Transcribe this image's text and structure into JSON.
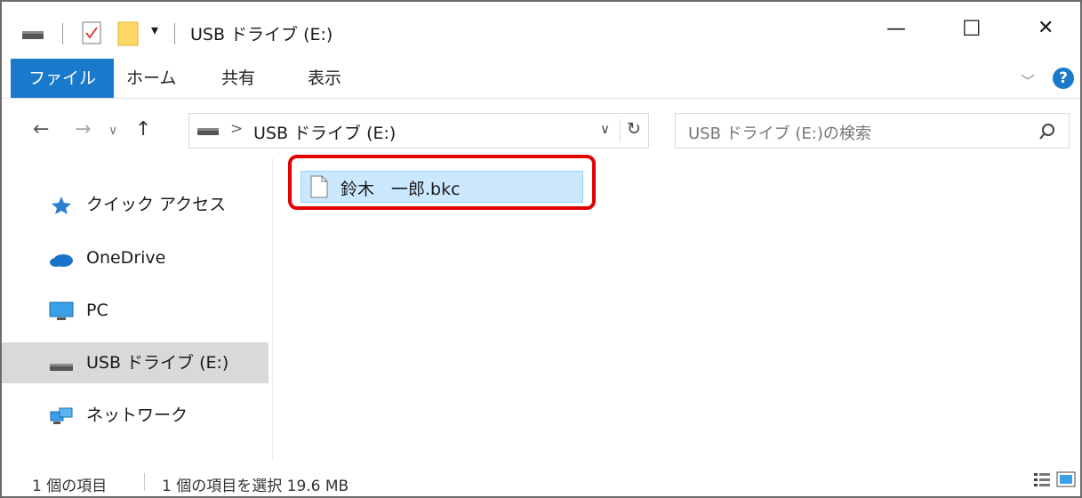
{
  "window": {
    "title": "USB ドライブ (E:)",
    "controls": {
      "minimize": "—",
      "maximize": "☐",
      "close": "✕"
    }
  },
  "ribbon": {
    "tabs": [
      "ファイル",
      "ホーム",
      "共有",
      "表示"
    ],
    "help_label": "?"
  },
  "address": {
    "path_sep": ">",
    "path": "USB ドライブ (E:)",
    "search_placeholder": "USB ドライブ (E:)の検索"
  },
  "nav": {
    "items": [
      {
        "label": "クイック アクセス",
        "icon": "star-icon"
      },
      {
        "label": "OneDrive",
        "icon": "cloud-icon"
      },
      {
        "label": "PC",
        "icon": "monitor-icon"
      },
      {
        "label": "USB ドライブ (E:)",
        "icon": "drive-icon",
        "selected": true
      },
      {
        "label": "ネットワーク",
        "icon": "network-icon"
      }
    ]
  },
  "files": [
    {
      "name": "鈴木　一郎.bkc",
      "selected": true
    }
  ],
  "status": {
    "count": "1 個の項目",
    "selected": "1 個の項目を選択  19.6 MB"
  },
  "colors": {
    "accent": "#1979ca",
    "selection": "#cce8ff",
    "highlight_box": "#e00000",
    "help": "#1979ca"
  }
}
